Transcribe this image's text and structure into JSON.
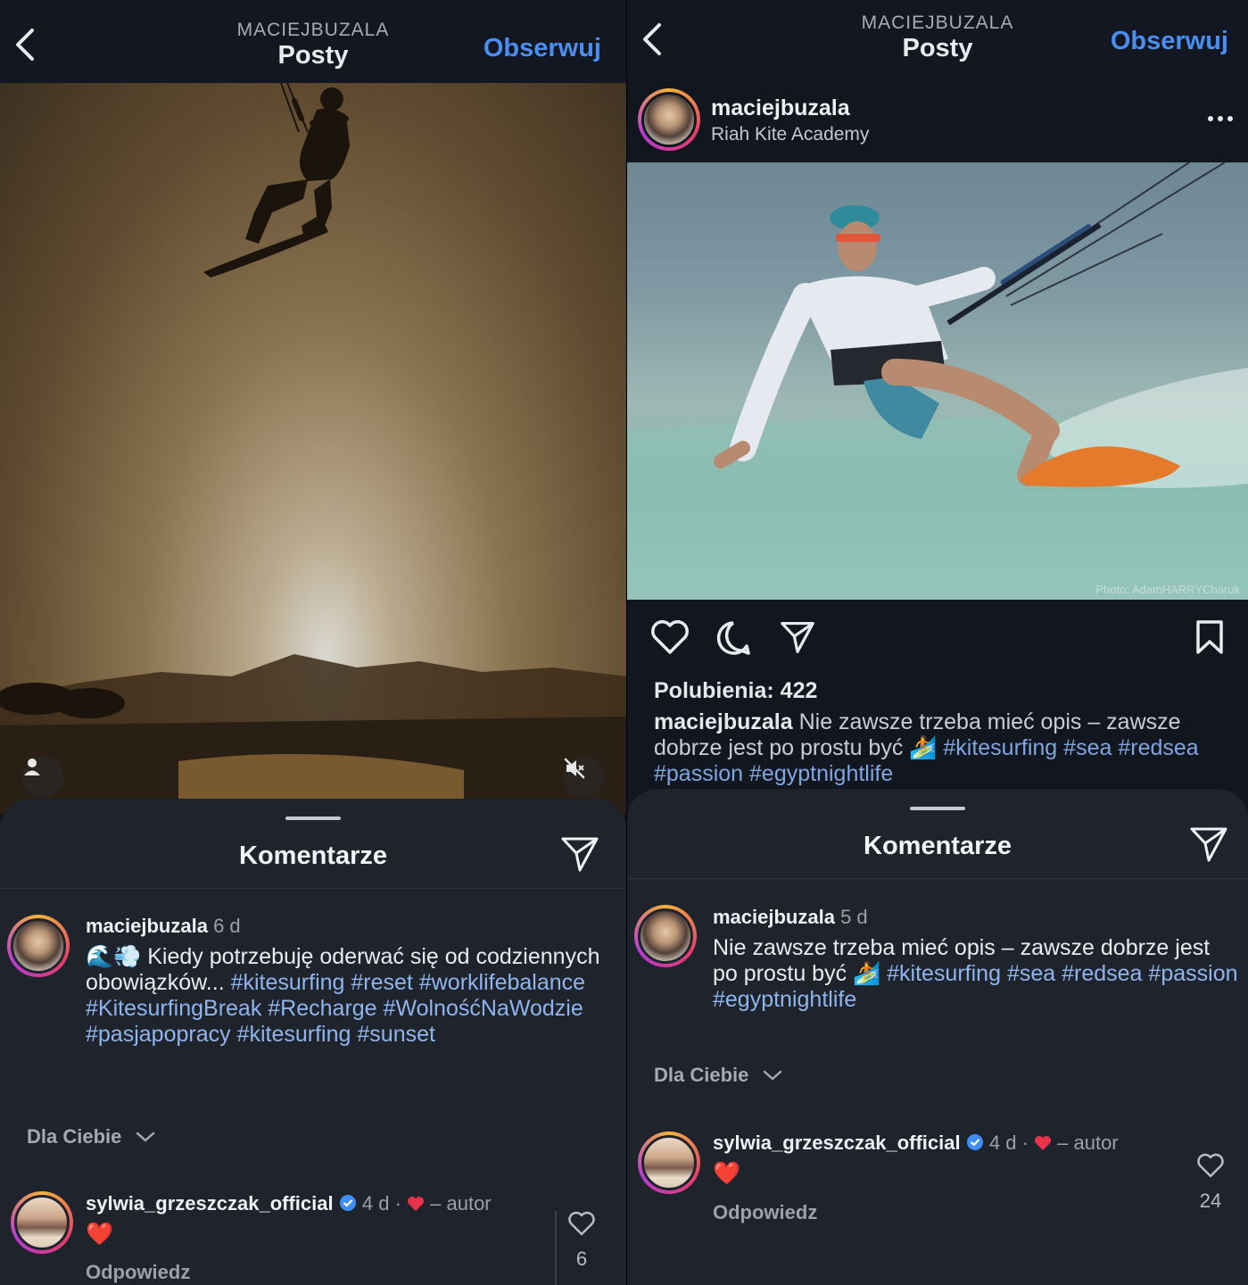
{
  "left": {
    "header": {
      "username": "MACIEJBUZALA",
      "title": "Posty",
      "follow": "Obserwuj"
    },
    "comments": {
      "title": "Komentarze",
      "main": {
        "user": "maciejbuzala",
        "time": "6 d",
        "emoji": "🌊💨",
        "text_plain": "Kiedy potrzebuję oderwać się od codziennych obowiązków...",
        "tags": [
          "#kitesurfing",
          "#reset",
          "#worklifebalance",
          "#KitesurfingBreak",
          "#Recharge",
          "#WolnośćNaWodzie",
          "#pasjapopracy",
          "#kitesurfing",
          "#sunset"
        ]
      },
      "filter": "Dla Ciebie",
      "reply_comment": {
        "user": "sylwia_grzeszczak_official",
        "time": "4 d",
        "author_label": "– autor",
        "text": "❤️",
        "reply": "Odpowiedz",
        "likes": "6"
      }
    }
  },
  "right": {
    "header": {
      "username": "MACIEJBUZALA",
      "title": "Posty",
      "follow": "Obserwuj"
    },
    "post": {
      "user": "maciejbuzala",
      "location": "Riah Kite Academy",
      "credit": "Photo: AdamHARRYCharuk",
      "likes": "Polubienia: 422",
      "caption_user": "maciejbuzala",
      "caption_text": "Nie zawsze trzeba mieć opis – zawsze dobrze jest po prostu być 🏄",
      "caption_tags": [
        "#kitesurfing",
        "#sea",
        "#redsea",
        "#passion",
        "#egyptnightlife"
      ]
    },
    "comments": {
      "title": "Komentarze",
      "main": {
        "user": "maciejbuzala",
        "time": "5 d",
        "text_plain": "Nie zawsze trzeba mieć opis – zawsze dobrze jest po prostu być 🏄",
        "tags": [
          "#kitesurfing",
          "#sea",
          "#redsea",
          "#passion",
          "#egyptnightlife"
        ]
      },
      "filter": "Dla Ciebie",
      "reply_comment": {
        "user": "sylwia_grzeszczak_official",
        "time": "4 d",
        "author_label": "– autor",
        "text": "❤️",
        "reply": "Odpowiedz",
        "likes": "24"
      }
    }
  },
  "colors": {
    "accent": "#4a8ef0",
    "hashtag": "#8fb5ee",
    "heart": "#e8324a",
    "sheet": "#1f232c"
  }
}
